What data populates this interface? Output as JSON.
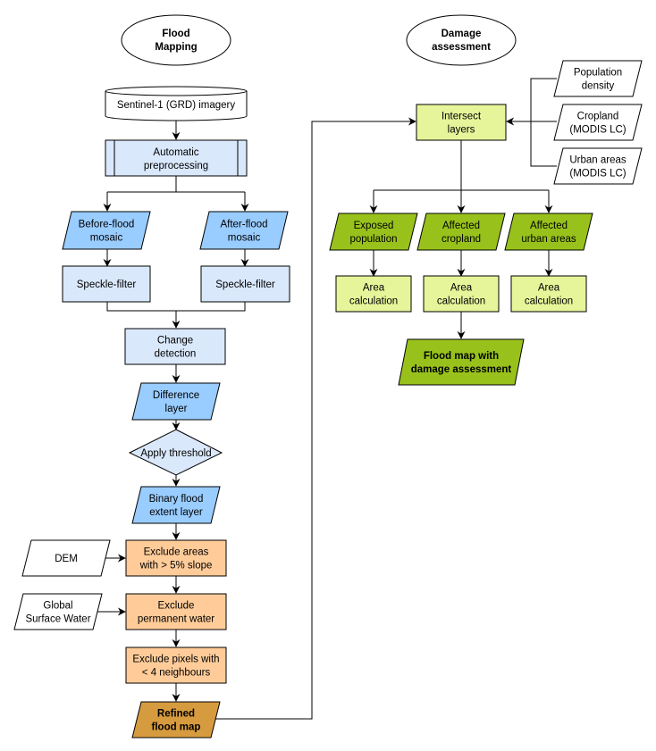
{
  "colors": {
    "process_blue": "#dae8fc",
    "data_blue": "#99ccff",
    "orange": "#ffcc99",
    "dark_orange": "#d79b3f",
    "light_green": "#e6f59a",
    "green": "#98c21b",
    "white": "#ffffff"
  },
  "headers": {
    "flood_mapping": [
      "Flood",
      "Mapping"
    ],
    "damage_assessment": [
      "Damage",
      "assessment"
    ]
  },
  "nodes": {
    "sentinel": [
      "Sentinel-1 (GRD) imagery"
    ],
    "preprocessing": [
      "Automatic",
      "preprocessing"
    ],
    "before_mosaic": [
      "Before-flood",
      "mosaic"
    ],
    "after_mosaic": [
      "After-flood",
      "mosaic"
    ],
    "speckle_left": [
      "Speckle-filter"
    ],
    "speckle_right": [
      "Speckle-filter"
    ],
    "change_detection": [
      "Change",
      "detection"
    ],
    "difference_layer": [
      "Difference",
      "layer"
    ],
    "apply_threshold": [
      "Apply threshold"
    ],
    "binary_flood": [
      "Binary flood",
      "extent layer"
    ],
    "dem": [
      "DEM"
    ],
    "exclude_slope": [
      "Exclude areas",
      "with > 5% slope"
    ],
    "global_surface_water": [
      "Global",
      "Surface Water"
    ],
    "exclude_permanent": [
      "Exclude",
      "permanent water"
    ],
    "exclude_pixels": [
      "Exclude pixels with",
      "< 4 neighbours"
    ],
    "refined_flood_map": [
      "Refined",
      "flood map"
    ],
    "population_density": [
      "Population",
      "density"
    ],
    "cropland_modis": [
      "Cropland",
      "(MODIS LC)"
    ],
    "urban_modis": [
      "Urban areas",
      "(MODIS LC)"
    ],
    "intersect_layers": [
      "Intersect",
      "layers"
    ],
    "exposed_population": [
      "Exposed",
      "population"
    ],
    "affected_cropland": [
      "Affected",
      "cropland"
    ],
    "affected_urban": [
      "Affected",
      "urban areas"
    ],
    "area_calc_1": [
      "Area",
      "calculation"
    ],
    "area_calc_2": [
      "Area",
      "calculation"
    ],
    "area_calc_3": [
      "Area",
      "calculation"
    ],
    "final_map": [
      "Flood map with",
      "damage assessment"
    ]
  }
}
